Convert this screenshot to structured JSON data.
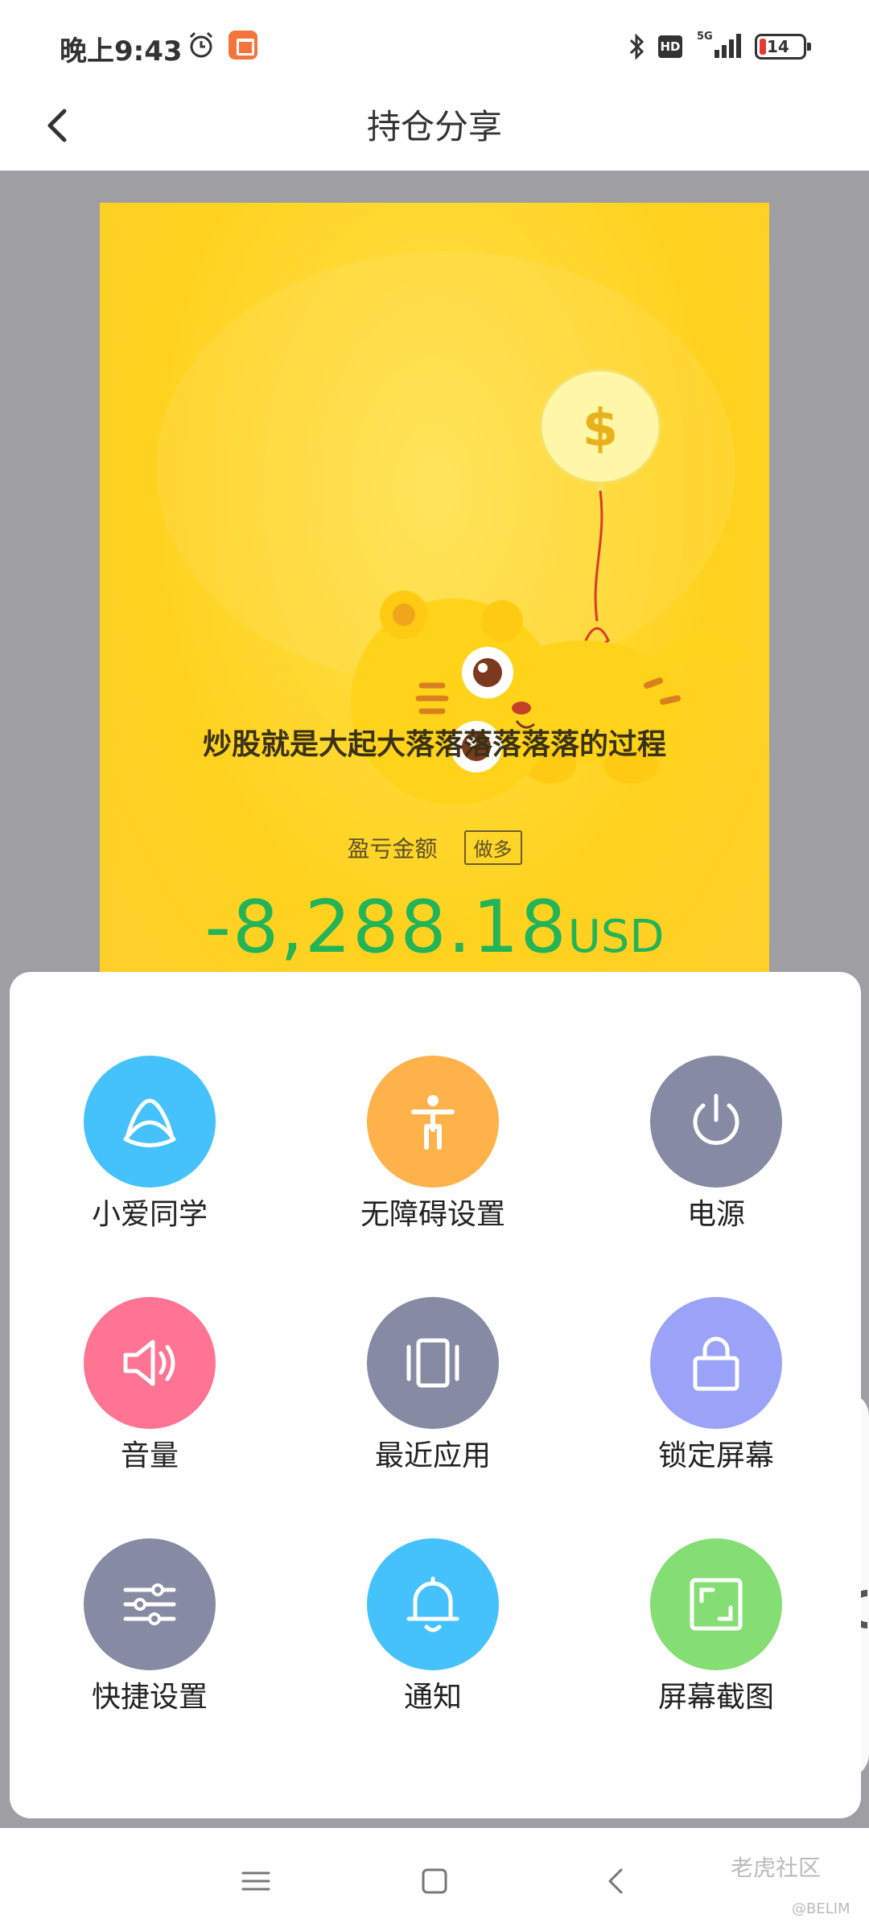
{
  "status_bar": {
    "time": "晚上9:43",
    "network": "5G",
    "hd_badge": "HD",
    "battery": "14",
    "icons": [
      "alarm-icon",
      "app-notification-icon",
      "bluetooth-icon",
      "hd-icon",
      "signal-icon",
      "battery-icon"
    ]
  },
  "header": {
    "title": "持仓分享",
    "back_icon": "chevron-left-icon"
  },
  "share_card": {
    "slogan": "炒股就是大起大落落落落落落的过程",
    "pnl_label": "盈亏金额",
    "position_tag": "做多",
    "pnl_amount": "-8,288.18",
    "pnl_currency": "USD",
    "amount_color": "#22b456",
    "background_color": "#ffd21f",
    "illustration": "tiger-with-dollar-balloon"
  },
  "quick_panel": {
    "tiles": [
      {
        "label": "小爱同学",
        "icon": "xiaoai-icon",
        "color": "#45c2fc"
      },
      {
        "label": "无障碍设置",
        "icon": "accessibility-icon",
        "color": "#ffb14a"
      },
      {
        "label": "电源",
        "icon": "power-icon",
        "color": "#868aa3"
      },
      {
        "label": "音量",
        "icon": "volume-icon",
        "color": "#ff7393"
      },
      {
        "label": "最近应用",
        "icon": "recent-apps-icon",
        "color": "#868aa3"
      },
      {
        "label": "锁定屏幕",
        "icon": "lock-icon",
        "color": "#9aa3f7"
      },
      {
        "label": "快捷设置",
        "icon": "sliders-icon",
        "color": "#868aa3"
      },
      {
        "label": "通知",
        "icon": "bell-icon",
        "color": "#45c2fc"
      },
      {
        "label": "屏幕截图",
        "icon": "screenshot-icon",
        "color": "#84de73"
      }
    ]
  },
  "nav_bar": {
    "icons": [
      "menu-icon",
      "home-icon",
      "back-icon"
    ],
    "watermark": "老虎社区",
    "watermark_user": "@BELIM"
  }
}
